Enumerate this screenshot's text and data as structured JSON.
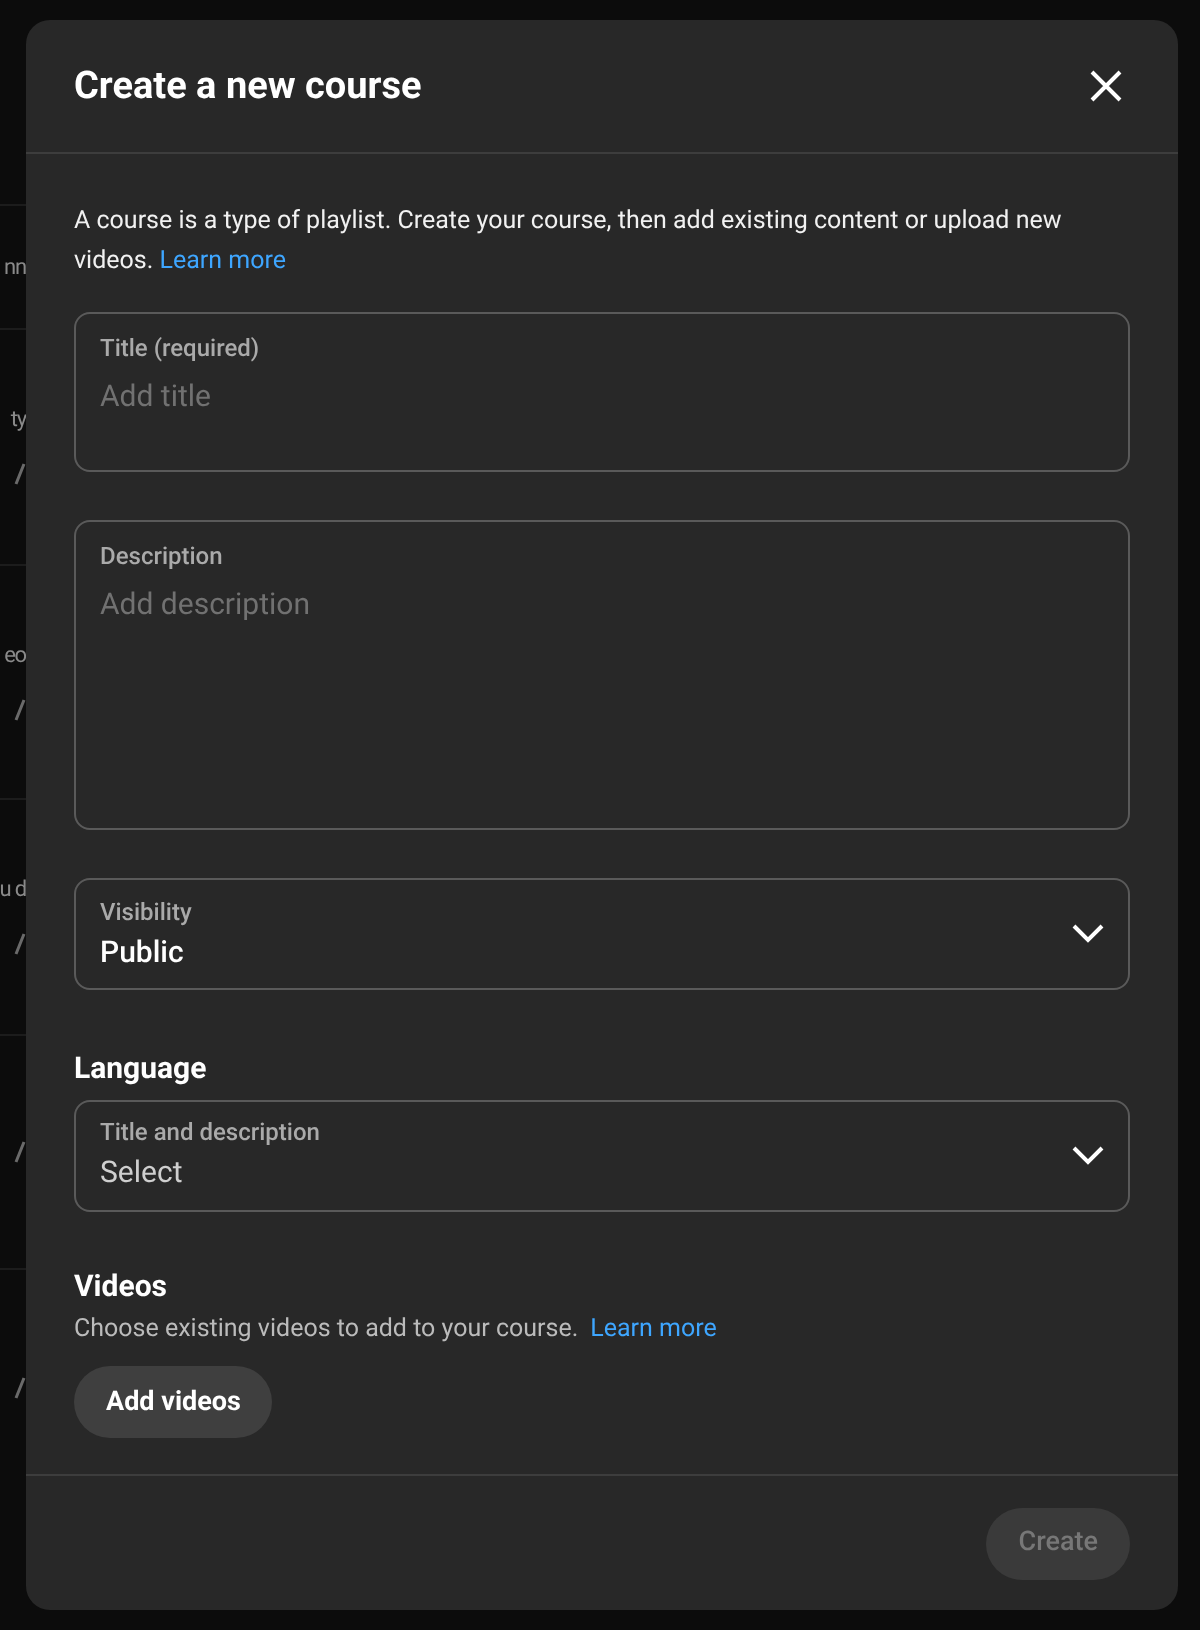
{
  "background_rows": [
    {
      "kind": "header",
      "text": "nn"
    },
    {
      "kind": "item",
      "text": "ty"
    },
    {
      "kind": "item",
      "text": "eo"
    },
    {
      "kind": "item",
      "text": "u d"
    },
    {
      "kind": "item"
    },
    {
      "kind": "item"
    }
  ],
  "dialog": {
    "title": "Create a new course",
    "intro": "A course is a type of playlist. Create your course, then add existing content or upload new videos.",
    "intro_link": "Learn more",
    "title_field": {
      "label": "Title (required)",
      "placeholder": "Add title"
    },
    "description_field": {
      "label": "Description",
      "placeholder": "Add description"
    },
    "visibility": {
      "label": "Visibility",
      "value": "Public"
    },
    "language": {
      "heading": "Language",
      "label": "Title and description",
      "value": "Select",
      "is_placeholder": true
    },
    "videos": {
      "heading": "Videos",
      "text": "Choose existing videos to add to your course.",
      "link": "Learn more",
      "button": "Add videos"
    },
    "create_button": {
      "label": "Create",
      "disabled": true
    }
  }
}
